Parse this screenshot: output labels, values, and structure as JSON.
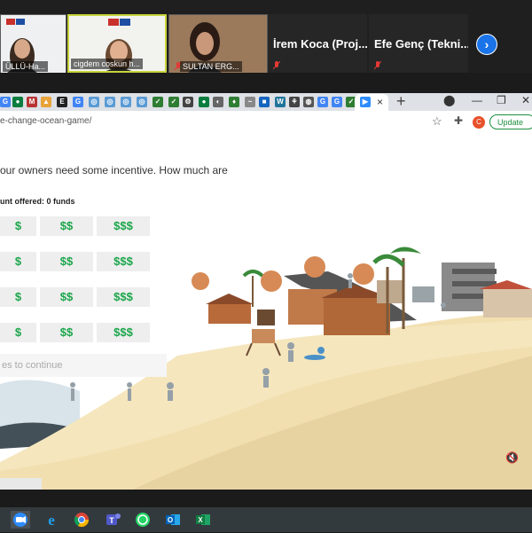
{
  "zoom": {
    "participants": [
      {
        "name": "ÜLLÜ-Ha...",
        "type": "video"
      },
      {
        "name": "cigdem coskun h...",
        "type": "video"
      },
      {
        "name": "SULTAN ERG...",
        "type": "video"
      },
      {
        "name": "İrem Koca (Proj...",
        "type": "name-only"
      },
      {
        "name": "Efe Genç (Tekni...",
        "type": "name-only"
      }
    ],
    "next_icon": "chevron-right-icon"
  },
  "browser": {
    "url": "e-change-ocean-game/",
    "profile_initial": "C",
    "update_label": "Update",
    "tab_close": "×",
    "new_tab": "+",
    "window_controls": [
      "—",
      "❐",
      "✕"
    ]
  },
  "game": {
    "question": "our owners need some incentive. How much are",
    "amount_label": "unt offered: 0 funds",
    "price_rows": [
      [
        "$",
        "$$",
        "$$$"
      ],
      [
        "$",
        "$$",
        "$$$"
      ],
      [
        "$",
        "$$",
        "$$$"
      ],
      [
        "$",
        "$$",
        "$$$"
      ]
    ],
    "continue_placeholder": "es to continue",
    "colors": {
      "accent_green": "#1aa64a",
      "button_bg": "#eeeeee",
      "sand": "#f1dfb0"
    }
  },
  "taskbar": {
    "apps": [
      "zoom-icon",
      "internet-explorer-icon",
      "chrome-icon",
      "teams-icon",
      "whatsapp-icon",
      "outlook-icon",
      "excel-icon"
    ]
  }
}
